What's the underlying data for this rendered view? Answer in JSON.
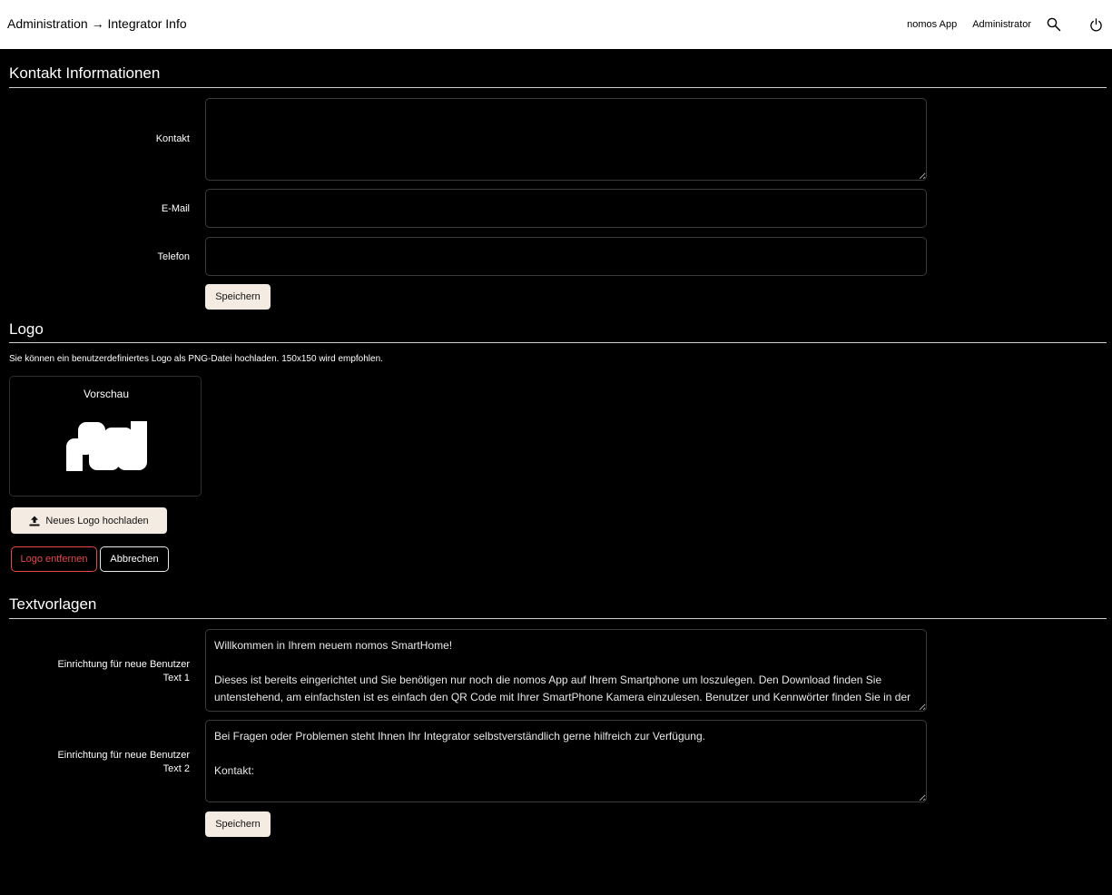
{
  "header": {
    "breadcrumb": "Administration → Integrator Info",
    "app_link": "nomos App",
    "user": "Administrator",
    "search_icon": "search-icon",
    "power_icon": "power-icon"
  },
  "contact": {
    "title": "Kontakt Informationen",
    "kontakt_label": "Kontakt",
    "kontakt_value": "",
    "email_label": "E-Mail",
    "email_value": "",
    "email_placeholder": "",
    "telefon_label": "Telefon",
    "telefon_value": "",
    "telefon_placeholder": "",
    "save_label": "Speichern"
  },
  "logo": {
    "title": "Logo",
    "info": "Sie können ein benutzerdefiniertes Logo als PNG-Datei hochladen. 150x150 wird empfohlen.",
    "preview_label": "Vorschau",
    "upload_label": "Neues Logo hochladen",
    "upload_icon": "upload-icon",
    "remove_label": "Logo entfernen",
    "cancel_label": "Abbrechen",
    "logo_icon": "nomos-logo"
  },
  "templates": {
    "title": "Textvorlagen",
    "text1_label_line1": "Einrichtung für neue Benutzer",
    "text1_label_line2": "Text 1",
    "text1_value": "Willkommen in Ihrem neuem nomos SmartHome!\n\nDieses ist bereits eingerichtet und Sie benötigen nur noch die nomos App auf Ihrem Smartphone um loszulegen. Den Download finden Sie untenstehend, am einfachsten ist es einfach den QR Code mit Ihrer SmartPhone Kamera einzulesen. Benutzer und Kennwörter finden Sie in der",
    "text2_label_line1": "Einrichtung für neue Benutzer",
    "text2_label_line2": "Text 2",
    "text2_value": "Bei Fragen oder Problemen steht Ihnen Ihr Integrator selbstverständlich gerne hilfreich zur Verfügung.\n\nKontakt:",
    "save_label": "Speichern"
  },
  "colors": {
    "background": "#000000",
    "header_bg": "#ffffff",
    "button_light": "#f4ece2",
    "danger": "#e5484d"
  }
}
